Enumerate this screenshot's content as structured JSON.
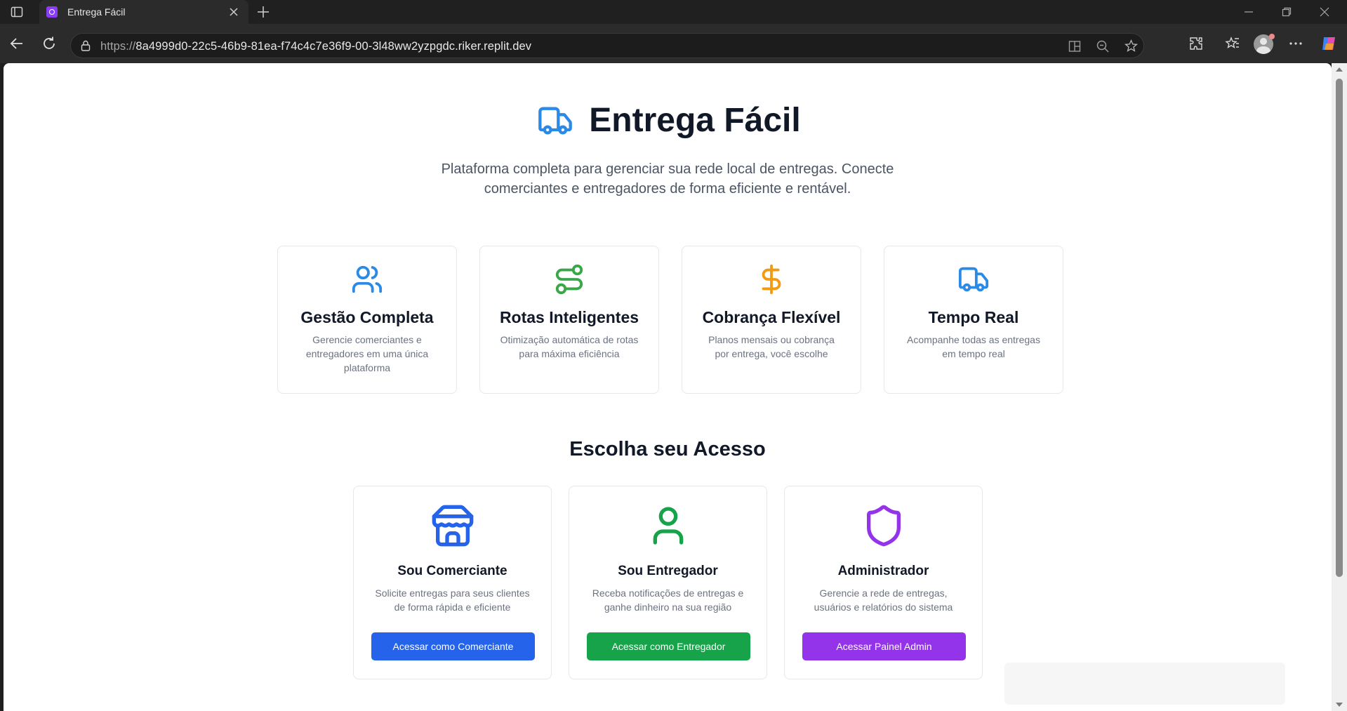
{
  "browser": {
    "tab_title": "Entrega Fácil",
    "url_prefix": "https://",
    "url_host": "8a4999d0-22c5-46b9-81ea-f74c4c7e36f9-00-3l48ww2yzpgdc.riker.replit.dev",
    "icons": [
      "tab-actions-icon",
      "close-icon",
      "plus-icon",
      "minimize-icon",
      "restore-icon",
      "window-close-icon",
      "back-icon",
      "refresh-icon",
      "lock-icon",
      "split-screen-icon",
      "zoom-out-icon",
      "star-icon",
      "extensions-icon",
      "favorites-icon",
      "profile-icon",
      "more-icon",
      "copilot-icon"
    ]
  },
  "hero": {
    "title": "Entrega Fácil",
    "subtitle": "Plataforma completa para gerenciar sua rede local de entregas. Conecte comerciantes e entregadores de forma eficiente e rentável.",
    "icon": "truck-icon",
    "icon_color": "#2b8ae6"
  },
  "features": [
    {
      "icon": "users-icon",
      "color": "#2b8ae6",
      "title": "Gestão Completa",
      "desc": "Gerencie comerciantes e entregadores em uma única plataforma"
    },
    {
      "icon": "route-icon",
      "color": "#3aa64a",
      "title": "Rotas Inteligentes",
      "desc": "Otimização automática de rotas para máxima eficiência"
    },
    {
      "icon": "dollar-icon",
      "color": "#f29a11",
      "title": "Cobrança Flexível",
      "desc": "Planos mensais ou cobrança por entrega, você escolhe"
    },
    {
      "icon": "truck-icon",
      "color": "#2b8ae6",
      "title": "Tempo Real",
      "desc": "Acompanhe todas as entregas em tempo real"
    }
  ],
  "access": {
    "title": "Escolha seu Acesso",
    "cards": [
      {
        "icon": "store-icon",
        "color": "#2563eb",
        "title": "Sou Comerciante",
        "desc": "Solicite entregas para seus clientes de forma rápida e eficiente",
        "button": "Acessar como Comerciante"
      },
      {
        "icon": "user-icon",
        "color": "#16a34a",
        "title": "Sou Entregador",
        "desc": "Receba notificações de entregas e ganhe dinheiro na sua região",
        "button": "Acessar como Entregador"
      },
      {
        "icon": "shield-icon",
        "color": "#9333ea",
        "title": "Administrador",
        "desc": "Gerencie a rede de entregas, usuários e relatórios do sistema",
        "button": "Acessar Painel Admin"
      }
    ]
  }
}
